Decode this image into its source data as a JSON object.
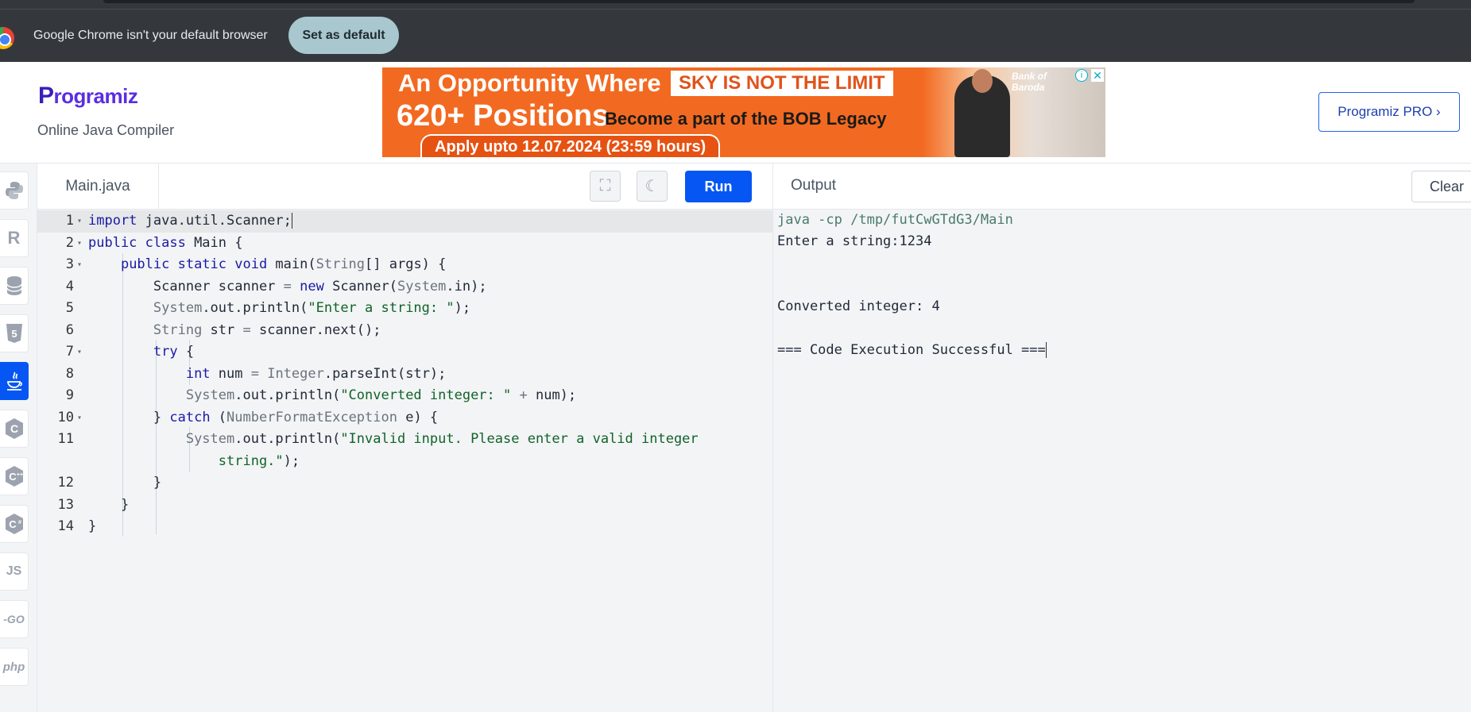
{
  "chrome_bar": {
    "message": "Google Chrome isn't your default browser",
    "button_label": "Set as default"
  },
  "header": {
    "logo_p": "P",
    "logo_rest": "rogramiz",
    "subtitle": "Online Java Compiler",
    "pro_button": "Programiz PRO ›"
  },
  "ad": {
    "line1": "An Opportunity Where",
    "highlight": "SKY IS NOT THE LIMIT",
    "line2": "620+ Positions",
    "line2b": "Become a part of the BOB Legacy",
    "pill": "Apply upto 12.07.2024 (23:59 hours)",
    "brand": "Bank of Baroda",
    "info": "i",
    "close": "✕"
  },
  "sidebar": {
    "languages": [
      "python",
      "r",
      "sql",
      "html",
      "java",
      "c",
      "cpp",
      "csharp",
      "js",
      "go",
      "php"
    ],
    "active": "java",
    "js_label": "JS",
    "go_label": "-GO",
    "php_label": "php",
    "r_label": "R"
  },
  "editor": {
    "filename": "Main.java",
    "run_label": "Run",
    "fullscreen_icon": "⛶",
    "theme_icon": "☾"
  },
  "code": [
    {
      "num": "1",
      "fold": true
    },
    {
      "num": "2",
      "fold": true
    },
    {
      "num": "3",
      "fold": true
    },
    {
      "num": "4",
      "fold": false
    },
    {
      "num": "5",
      "fold": false
    },
    {
      "num": "6",
      "fold": false
    },
    {
      "num": "7",
      "fold": true
    },
    {
      "num": "8",
      "fold": false
    },
    {
      "num": "9",
      "fold": false
    },
    {
      "num": "10",
      "fold": true
    },
    {
      "num": "11",
      "fold": false
    },
    {
      "num": "",
      "fold": false
    },
    {
      "num": "12",
      "fold": false
    },
    {
      "num": "13",
      "fold": false
    },
    {
      "num": "14",
      "fold": false
    }
  ],
  "code_tokens": {
    "l1_kw": "import",
    "l1_rest": " java.util.Scanner;",
    "l2_kw": "public class",
    "l2_rest": " Main {",
    "l3_kw": "public static void",
    "l3_rest": " main(",
    "l3_ty": "String",
    "l3_rest2": "[] args) {",
    "l4_a": "Scanner scanner ",
    "l4_op": "=",
    "l4_kw": " new",
    "l4_b": " Scanner(",
    "l4_ty": "System",
    "l4_c": ".in);",
    "l5_ty": "System",
    "l5_a": ".out.println(",
    "l5_str": "\"Enter a string: \"",
    "l5_b": ");",
    "l6_ty": "String",
    "l6_a": " str ",
    "l6_op": "=",
    "l6_b": " scanner.next();",
    "l7_kw": "try",
    "l7_a": " {",
    "l8_kw": "int",
    "l8_a": " num ",
    "l8_op": "=",
    "l8_ty": " Integer",
    "l8_b": ".parseInt(str);",
    "l9_ty": "System",
    "l9_a": ".out.println(",
    "l9_str": "\"Converted integer: \"",
    "l9_op": " +",
    "l9_b": " num);",
    "l10_a": "} ",
    "l10_kw": "catch",
    "l10_b": " (",
    "l10_ty": "NumberFormatException",
    "l10_c": " e) {",
    "l11_ty": "System",
    "l11_a": ".out.println(",
    "l11_str": "\"Invalid input. Please enter a valid integer",
    "l11w_str": "string.\"",
    "l11w_a": ");",
    "l12": "}",
    "l13": "}",
    "l14": "}"
  },
  "output": {
    "title": "Output",
    "clear_label": "Clear",
    "command": "java -cp /tmp/futCwGTdG3/Main",
    "line1": "Enter a string:1234",
    "line2": "Converted integer: 4",
    "line3": "=== Code Execution Successful ==="
  }
}
